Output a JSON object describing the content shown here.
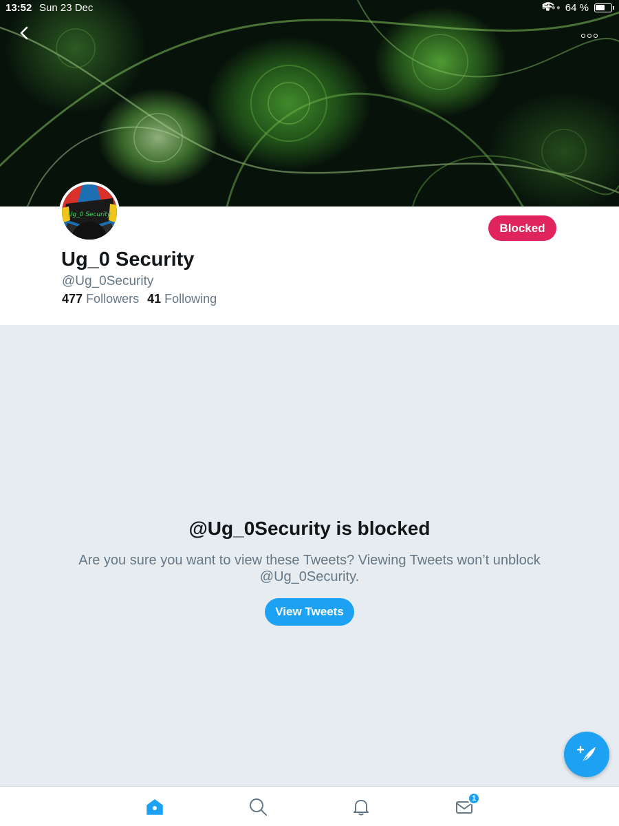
{
  "status_bar": {
    "time": "13:52",
    "date": "Sun 23 Dec",
    "battery_percent_label": "64 %",
    "battery_level": 0.64,
    "icons": [
      "signal-icon",
      "wifi-icon",
      "location-arrow-icon",
      "battery-icon"
    ]
  },
  "nav": {
    "back_icon": "chevron-left-icon",
    "more_icon": "more-dots-icon"
  },
  "profile": {
    "avatar_text": "Ug_0 Security",
    "display_name": "Ug_0 Security",
    "handle": "@Ug_0Security",
    "followers_count": "477",
    "followers_label": "Followers",
    "following_count": "41",
    "following_label": "Following",
    "blocked_button_label": "Blocked"
  },
  "blocked_panel": {
    "title": "@Ug_0Security is blocked",
    "message": "Are you sure you want to view these Tweets? Viewing Tweets won’t unblock @Ug_0Security.",
    "view_button_label": "View Tweets"
  },
  "tab_bar": {
    "tabs": [
      {
        "name": "home",
        "icon": "home-icon",
        "active": true
      },
      {
        "name": "search",
        "icon": "search-icon",
        "active": false
      },
      {
        "name": "notifications",
        "icon": "bell-icon",
        "active": false
      },
      {
        "name": "messages",
        "icon": "mail-icon",
        "active": false
      }
    ],
    "messages_badge": "1"
  },
  "colors": {
    "accent": "#1da1f2",
    "blocked": "#e0245e",
    "text_primary": "#14171a",
    "text_secondary": "#657786",
    "background": "#e6ecf0"
  }
}
